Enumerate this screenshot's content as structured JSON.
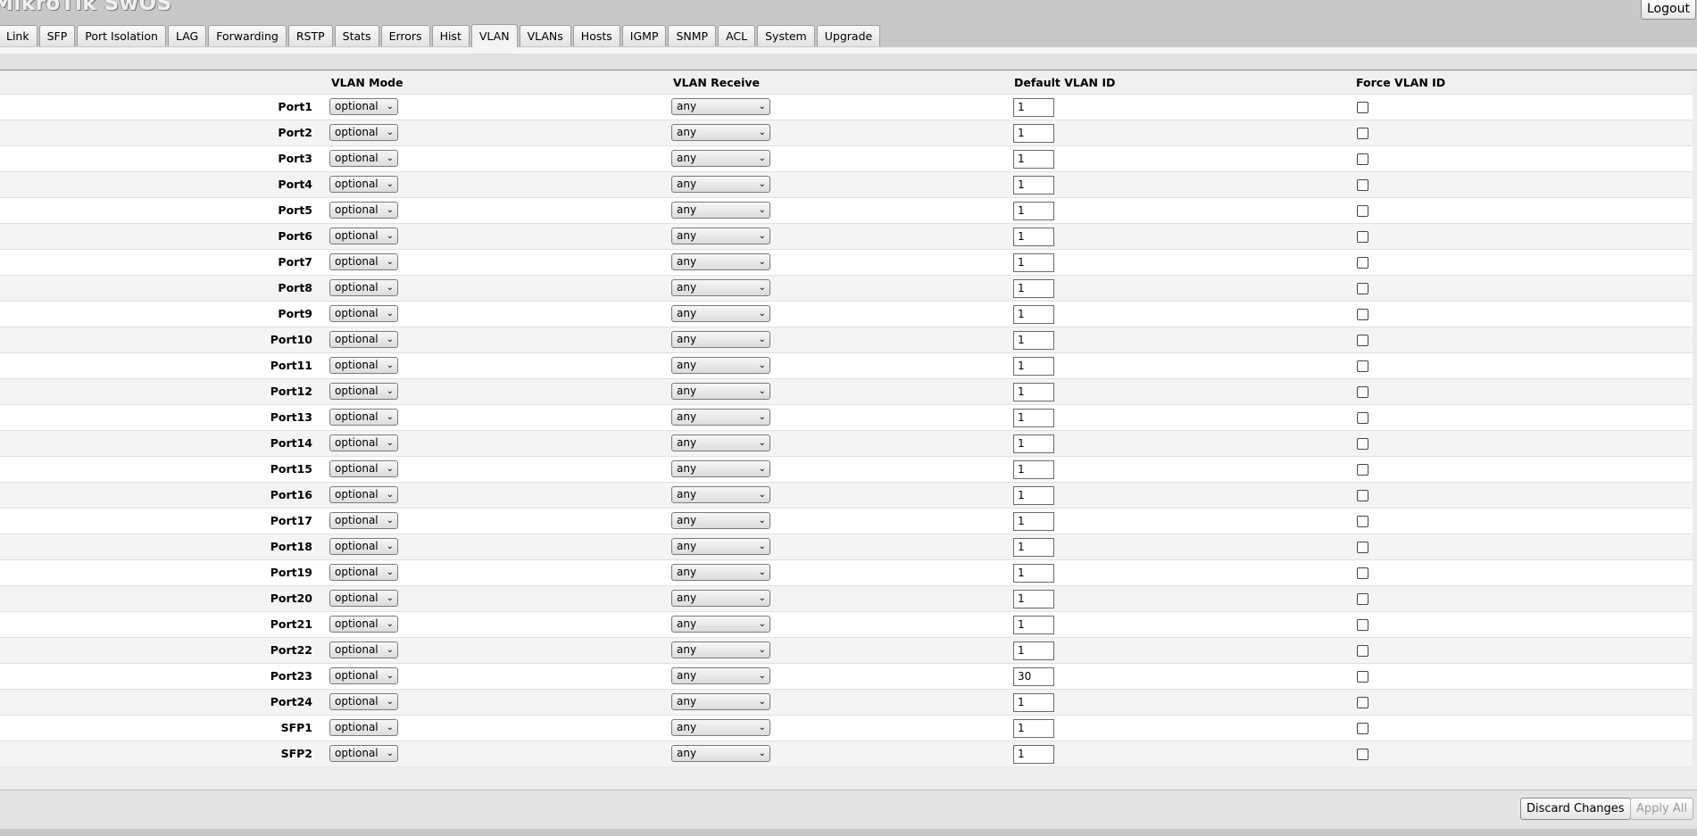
{
  "app": {
    "title": "MikroTik SwOS",
    "logout_label": "Logout"
  },
  "tabs": [
    {
      "label": "Link",
      "active": false
    },
    {
      "label": "SFP",
      "active": false
    },
    {
      "label": "Port Isolation",
      "active": false
    },
    {
      "label": "LAG",
      "active": false
    },
    {
      "label": "Forwarding",
      "active": false
    },
    {
      "label": "RSTP",
      "active": false
    },
    {
      "label": "Stats",
      "active": false
    },
    {
      "label": "Errors",
      "active": false
    },
    {
      "label": "Hist",
      "active": false
    },
    {
      "label": "VLAN",
      "active": true
    },
    {
      "label": "VLANs",
      "active": false
    },
    {
      "label": "Hosts",
      "active": false
    },
    {
      "label": "IGMP",
      "active": false
    },
    {
      "label": "SNMP",
      "active": false
    },
    {
      "label": "ACL",
      "active": false
    },
    {
      "label": "System",
      "active": false
    },
    {
      "label": "Upgrade",
      "active": false
    }
  ],
  "table": {
    "headers": {
      "vlan_mode": "VLAN Mode",
      "vlan_receive": "VLAN Receive",
      "default_vlan_id": "Default VLAN ID",
      "force_vlan_id": "Force VLAN ID"
    },
    "rows": [
      {
        "port": "Port1",
        "vlan_mode": "optional",
        "vlan_receive": "any",
        "default_vlan_id": "1",
        "force_vlan_id": false
      },
      {
        "port": "Port2",
        "vlan_mode": "optional",
        "vlan_receive": "any",
        "default_vlan_id": "1",
        "force_vlan_id": false
      },
      {
        "port": "Port3",
        "vlan_mode": "optional",
        "vlan_receive": "any",
        "default_vlan_id": "1",
        "force_vlan_id": false
      },
      {
        "port": "Port4",
        "vlan_mode": "optional",
        "vlan_receive": "any",
        "default_vlan_id": "1",
        "force_vlan_id": false
      },
      {
        "port": "Port5",
        "vlan_mode": "optional",
        "vlan_receive": "any",
        "default_vlan_id": "1",
        "force_vlan_id": false
      },
      {
        "port": "Port6",
        "vlan_mode": "optional",
        "vlan_receive": "any",
        "default_vlan_id": "1",
        "force_vlan_id": false
      },
      {
        "port": "Port7",
        "vlan_mode": "optional",
        "vlan_receive": "any",
        "default_vlan_id": "1",
        "force_vlan_id": false
      },
      {
        "port": "Port8",
        "vlan_mode": "optional",
        "vlan_receive": "any",
        "default_vlan_id": "1",
        "force_vlan_id": false
      },
      {
        "port": "Port9",
        "vlan_mode": "optional",
        "vlan_receive": "any",
        "default_vlan_id": "1",
        "force_vlan_id": false
      },
      {
        "port": "Port10",
        "vlan_mode": "optional",
        "vlan_receive": "any",
        "default_vlan_id": "1",
        "force_vlan_id": false
      },
      {
        "port": "Port11",
        "vlan_mode": "optional",
        "vlan_receive": "any",
        "default_vlan_id": "1",
        "force_vlan_id": false
      },
      {
        "port": "Port12",
        "vlan_mode": "optional",
        "vlan_receive": "any",
        "default_vlan_id": "1",
        "force_vlan_id": false
      },
      {
        "port": "Port13",
        "vlan_mode": "optional",
        "vlan_receive": "any",
        "default_vlan_id": "1",
        "force_vlan_id": false
      },
      {
        "port": "Port14",
        "vlan_mode": "optional",
        "vlan_receive": "any",
        "default_vlan_id": "1",
        "force_vlan_id": false
      },
      {
        "port": "Port15",
        "vlan_mode": "optional",
        "vlan_receive": "any",
        "default_vlan_id": "1",
        "force_vlan_id": false
      },
      {
        "port": "Port16",
        "vlan_mode": "optional",
        "vlan_receive": "any",
        "default_vlan_id": "1",
        "force_vlan_id": false
      },
      {
        "port": "Port17",
        "vlan_mode": "optional",
        "vlan_receive": "any",
        "default_vlan_id": "1",
        "force_vlan_id": false
      },
      {
        "port": "Port18",
        "vlan_mode": "optional",
        "vlan_receive": "any",
        "default_vlan_id": "1",
        "force_vlan_id": false
      },
      {
        "port": "Port19",
        "vlan_mode": "optional",
        "vlan_receive": "any",
        "default_vlan_id": "1",
        "force_vlan_id": false
      },
      {
        "port": "Port20",
        "vlan_mode": "optional",
        "vlan_receive": "any",
        "default_vlan_id": "1",
        "force_vlan_id": false
      },
      {
        "port": "Port21",
        "vlan_mode": "optional",
        "vlan_receive": "any",
        "default_vlan_id": "1",
        "force_vlan_id": false
      },
      {
        "port": "Port22",
        "vlan_mode": "optional",
        "vlan_receive": "any",
        "default_vlan_id": "1",
        "force_vlan_id": false
      },
      {
        "port": "Port23",
        "vlan_mode": "optional",
        "vlan_receive": "any",
        "default_vlan_id": "30",
        "force_vlan_id": false
      },
      {
        "port": "Port24",
        "vlan_mode": "optional",
        "vlan_receive": "any",
        "default_vlan_id": "1",
        "force_vlan_id": false
      },
      {
        "port": "SFP1",
        "vlan_mode": "optional",
        "vlan_receive": "any",
        "default_vlan_id": "1",
        "force_vlan_id": false
      },
      {
        "port": "SFP2",
        "vlan_mode": "optional",
        "vlan_receive": "any",
        "default_vlan_id": "1",
        "force_vlan_id": false
      }
    ]
  },
  "footer": {
    "discard_label": "Discard Changes",
    "apply_label": "Apply All",
    "apply_enabled": false
  },
  "icons": {
    "select_chevron": "chevron-down-icon"
  },
  "colors": {
    "page_bg": "#c8c8c8",
    "row_odd": "#ffffff",
    "row_even": "#f4f4f4",
    "disabled_text": "#9a9a9a"
  }
}
